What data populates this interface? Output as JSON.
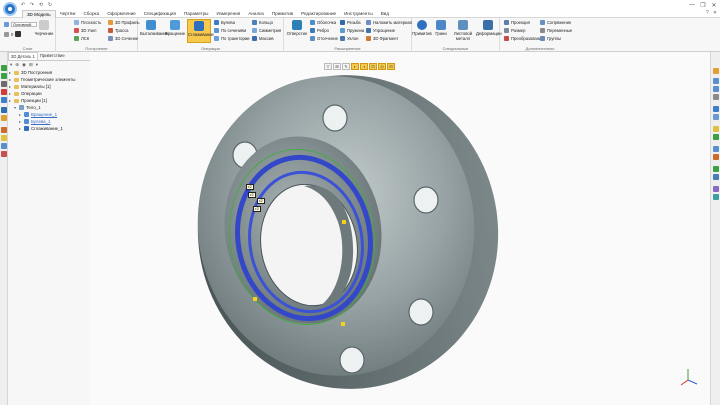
{
  "window": {
    "quick_access": [
      "↶",
      "↷",
      "⟲",
      "↻"
    ],
    "controls": [
      "—",
      "❐",
      "✕"
    ],
    "help": [
      "?",
      "✕"
    ]
  },
  "menu": {
    "tabs": [
      "3D Модель",
      "Чертёж",
      "Сборка",
      "Оформление",
      "Спецификация",
      "Параметры",
      "Измерения",
      "Анализ",
      "Примитив",
      "Редактирование",
      "Инструменты",
      "Вид"
    ],
    "active": "3D Модель"
  },
  "ribbon": {
    "layers": {
      "label": "Слои",
      "dropdown": "Основной",
      "num_value": "0",
      "sketch": "Черчение"
    },
    "construction": {
      "label": "Построение",
      "items": [
        "Плоскость",
        "3D Узел",
        "ЛСК",
        "3D Профиль",
        "Трасса",
        "3D Сечение"
      ]
    },
    "operations": {
      "label": "Операции",
      "big": [
        "Выталкивание",
        "Вращение",
        "Сглаживание"
      ],
      "items": [
        "Булева",
        "По сечениям",
        "По траектории",
        "Кольцо",
        "Симметрия",
        "Массив"
      ]
    },
    "advanced": {
      "label": "Расширенные",
      "big": "Отверстие",
      "items": [
        "Оболочка",
        "Ребро",
        "Отсечение",
        "Резьба",
        "Пружина",
        "Уклон",
        "Наложить материал",
        "Упрощение",
        "3D Фрагмент"
      ]
    },
    "special": {
      "label": "Специальные",
      "big": [
        "Примитив",
        "Грани",
        "Листовой металл",
        "Деформации"
      ]
    },
    "extra": {
      "label": "Дополнительно",
      "items": [
        "Проекция",
        "Размер",
        "Преобразование",
        "Сопряжение",
        "Переменные",
        "Группы"
      ]
    }
  },
  "panel": {
    "tabs": [
      "3D Деталь 1",
      "Приветствие"
    ],
    "toolbar": [
      "▾",
      "⊕",
      "◉",
      "⊞",
      "▾"
    ],
    "tree": [
      {
        "label": "3D Построения",
        "indent": 0,
        "type": "folder"
      },
      {
        "label": "Геометрические элементы",
        "indent": 0,
        "type": "folder"
      },
      {
        "label": "Материалы [1]",
        "indent": 0,
        "type": "folder"
      },
      {
        "label": "Операции",
        "indent": 0,
        "type": "folder"
      },
      {
        "label": "Проекции [1]",
        "indent": 0,
        "type": "folder"
      },
      {
        "label": "Тело_1",
        "indent": 1,
        "type": "body"
      },
      {
        "label": "Вращение_1",
        "indent": 2,
        "type": "link"
      },
      {
        "label": "Булева_1",
        "indent": 2,
        "type": "link"
      },
      {
        "label": "Сглаживание_1",
        "indent": 2,
        "type": "op"
      }
    ]
  },
  "viewport": {
    "toolbar": [
      "▽",
      "⊞",
      "✎",
      "◐",
      "◑",
      "⊡",
      "◎",
      "⊟"
    ],
    "dim_tags": [
      "r2",
      "r2",
      "r2",
      "r2"
    ],
    "axes": [
      "X",
      "Y",
      "Z"
    ]
  },
  "colors": {
    "accent": "#f6c94d",
    "selection": "#3348c9",
    "steel": "#8a9698",
    "brand": "#2b74c6"
  }
}
